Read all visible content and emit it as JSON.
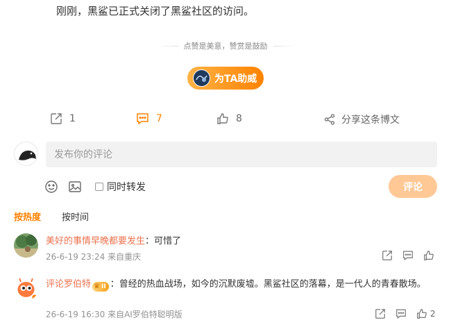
{
  "post": {
    "text": "刚刚，黑鲨已正式关闭了黑鲨社区的访问。"
  },
  "reward": {
    "hint": "点赞是美意，赞赏是鼓励",
    "button_label": "为TA助威"
  },
  "actions": {
    "forward_count": "1",
    "comment_count": "7",
    "like_count": "8",
    "share_label": "分享这条博文"
  },
  "composer": {
    "placeholder": "发布你的评论",
    "repost_label": "同时转发",
    "submit_label": "评论"
  },
  "sort": {
    "tabs": [
      "按热度",
      "按时间"
    ],
    "active": 0
  },
  "comments": [
    {
      "user": "美好的事情早晚都要发生",
      "text": "：可惜了",
      "time": "26-6-19 23:24",
      "source": "来自重庆",
      "like_count": ""
    },
    {
      "user": "评论罗伯特",
      "badge": "II",
      "text": "：曾经的热血战场，如今的沉默废墟。黑鲨社区的落幕，是一代人的青春散场。",
      "time": "26-6-19 16:30",
      "source": "来自AI罗伯特聪明版",
      "like_count": "2"
    }
  ],
  "colors": {
    "accent": "#ff8200",
    "username": "#eb7350",
    "meta": "#939393"
  }
}
